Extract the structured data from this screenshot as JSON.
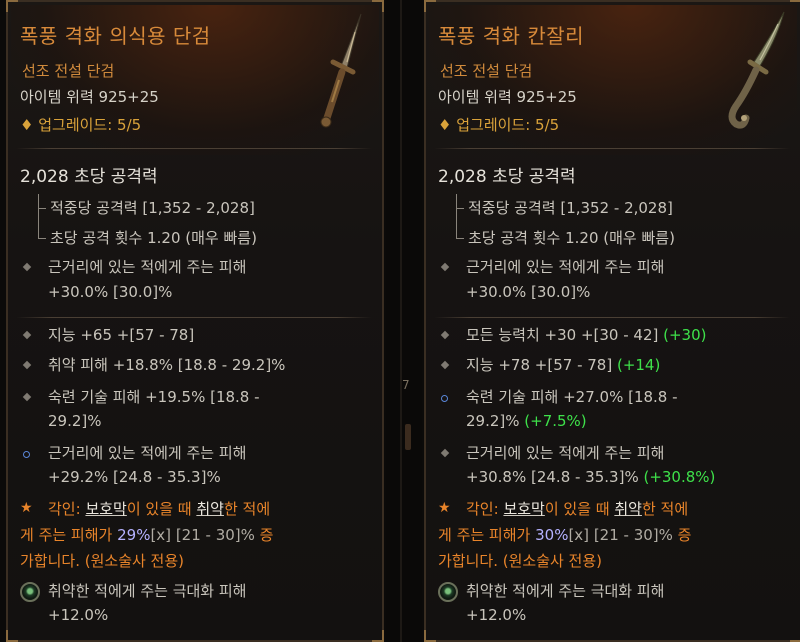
{
  "left": {
    "title": "폭풍 격화 의식용 단검",
    "subtitle": "선조 전설 단검",
    "power": "아이템 위력 925+25",
    "upgrade": "업그레이드: 5/5",
    "dps": "2,028 초당 공격력",
    "damage_per_hit": "적중당 공격력 [1,352 - 2,028]",
    "attack_speed": "초당 공격 횟수 1.20 (매우 빠름)",
    "implicit_1": "근거리에 있는 적에게 주는 피해",
    "implicit_2": "+30.0% [30.0]%",
    "aff1": "지능 +65 +[57 - 78]",
    "aff2": "취약 피해 +18.8% [18.8 - 29.2]%",
    "aff3a": "숙련 기술 피해 +19.5% [18.8 -",
    "aff3b": "29.2]%",
    "aff4a": "근거리에 있는 적에게 주는 피해",
    "aff4b": "+29.2% [24.8 - 35.3]%",
    "aspect_label": "각인: ",
    "aspect_barrier": "보호막",
    "aspect_1": "이 있을 때 ",
    "aspect_vuln": "취약",
    "aspect_2": "한 적에",
    "aspect_3": "게 주는 피해가 ",
    "aspect_value": "29%",
    "aspect_x": "[x]",
    "aspect_range": " [21 - 30]%",
    "aspect_4": " 증",
    "aspect_5": "가합니다. (원소술사 전용)",
    "gem_1": "취약한 적에게 주는 극대화 피해",
    "gem_2": "+12.0%"
  },
  "right": {
    "title": "폭풍 격화 칸잘리",
    "subtitle": "선조 전설 단검",
    "power": "아이템 위력 925+25",
    "upgrade": "업그레이드: 5/5",
    "dps": "2,028 초당 공격력",
    "damage_per_hit": "적중당 공격력 [1,352 - 2,028]",
    "attack_speed": "초당 공격 횟수 1.20 (매우 빠름)",
    "implicit_1": "근거리에 있는 적에게 주는 피해",
    "implicit_2": "+30.0% [30.0]%",
    "aff1": "모든 능력치 +30 +[30 - 42] ",
    "aff1_delta": "(+30)",
    "aff2": "지능 +78 +[57 - 78] ",
    "aff2_delta": "(+14)",
    "aff3a": "숙련 기술 피해 +27.0% [18.8 -",
    "aff3b": "29.2]% ",
    "aff3_delta": "(+7.5%)",
    "aff4a": "근거리에 있는 적에게 주는 피해",
    "aff4b": "+30.8% [24.8 - 35.3]% ",
    "aff4_delta": "(+30.8%)",
    "aspect_label": "각인: ",
    "aspect_barrier": "보호막",
    "aspect_1": "이 있을 때 ",
    "aspect_vuln": "취약",
    "aspect_2": "한 적에",
    "aspect_3": "게 주는 피해가 ",
    "aspect_value": "30%",
    "aspect_x": "[x]",
    "aspect_range": " [21 - 30]%",
    "aspect_4": " 증",
    "aspect_5": "가합니다. (원소술사 전용)",
    "gem_1": "취약한 적에게 주는 극대화 피해",
    "gem_2": "+12.0%"
  },
  "divider_mark": "7",
  "icons": {
    "upgrade": "diamond-icon",
    "aspect": "star-icon",
    "gem": "gem-socket-icon"
  },
  "colors": {
    "title": "#d88a3a",
    "positive_delta": "#3ee04a",
    "aspect": "#e8842a",
    "roll_value": "#b5b2ff"
  }
}
